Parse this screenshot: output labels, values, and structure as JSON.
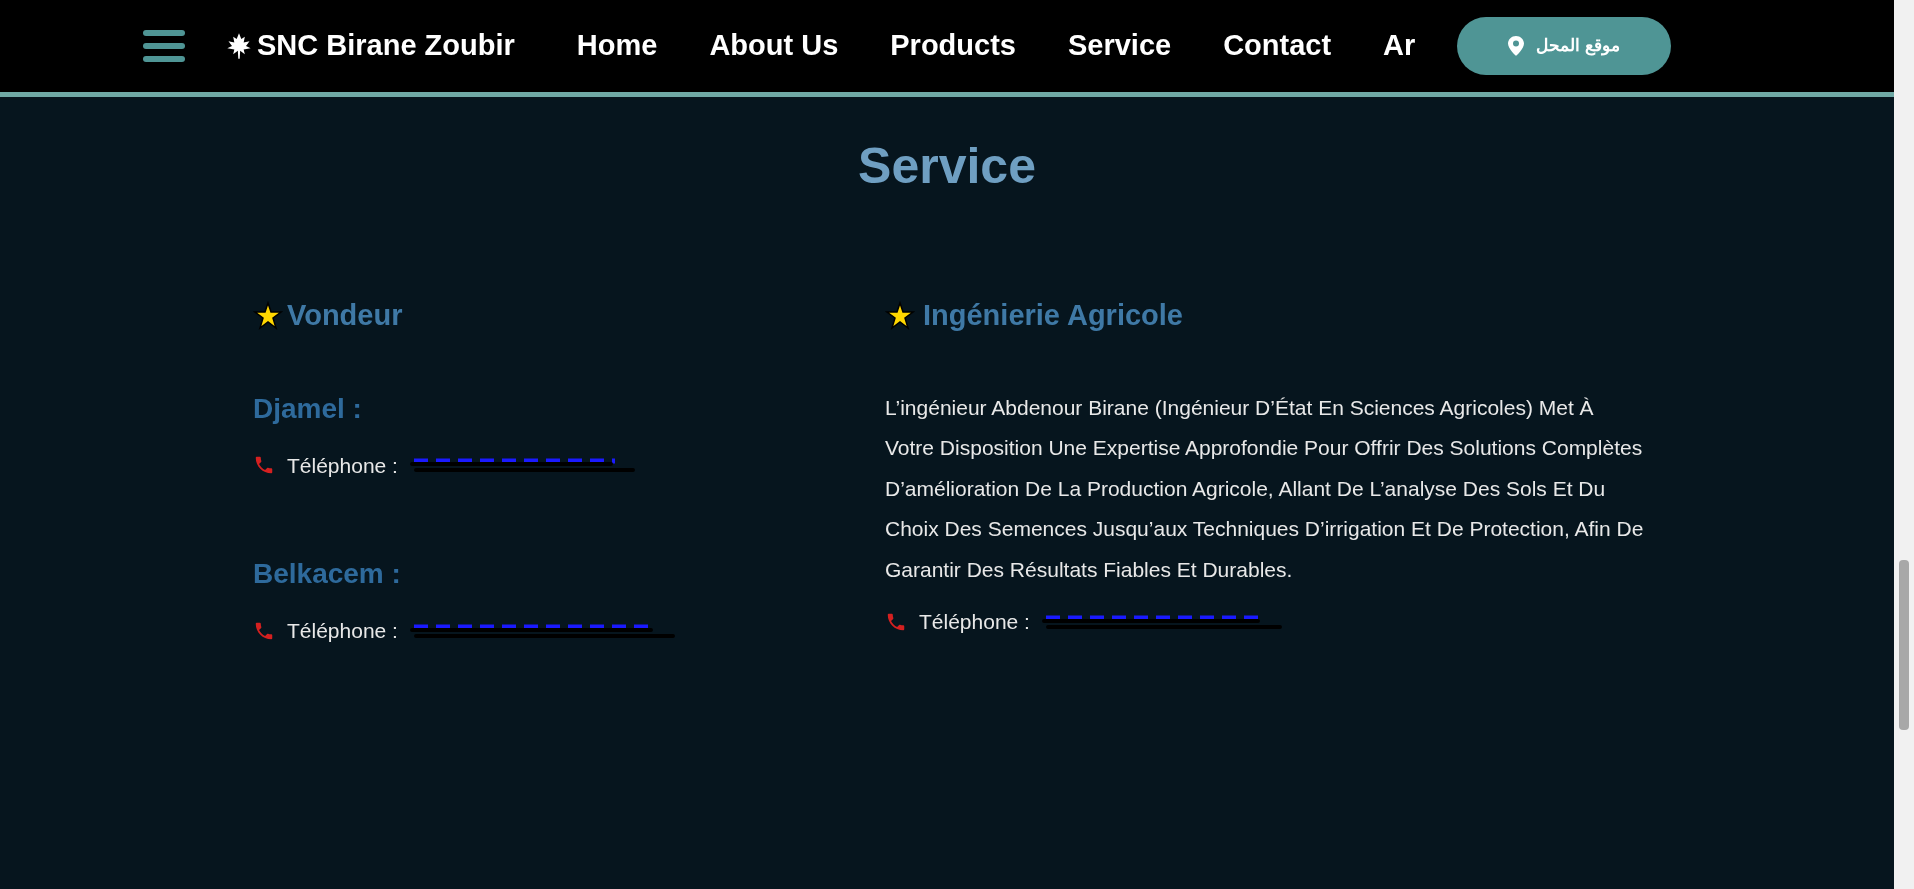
{
  "header": {
    "brand": "SNC Birane Zoubir",
    "nav": [
      {
        "label": "Home"
      },
      {
        "label": "About Us"
      },
      {
        "label": "Products"
      },
      {
        "label": "Service"
      },
      {
        "label": "Contact"
      },
      {
        "label": "Ar"
      }
    ],
    "location_button": "موقع المحل"
  },
  "title": "Service",
  "columns": [
    {
      "heading": "Vondeur",
      "contacts": [
        {
          "name": "Djamel :",
          "phone_label": "Téléphone :"
        },
        {
          "name": "Belkacem :",
          "phone_label": "Téléphone :"
        }
      ]
    },
    {
      "heading": "Ingénierie Agricole",
      "description": "L’ingénieur Abdenour Birane (Ingénieur D’État En Sciences Agricoles) Met À Votre Disposition Une Expertise Approfondie Pour Offrir Des Solutions Complètes D’amélioration De La Production Agricole, Allant De L’analyse Des Sols Et Du Choix Des Semences Jusqu’aux Techniques D’irrigation Et De Protection, Afin De Garantir Des Résultats Fiables Et Durables.",
      "contacts": [
        {
          "phone_label": "Téléphone :"
        }
      ]
    }
  ]
}
